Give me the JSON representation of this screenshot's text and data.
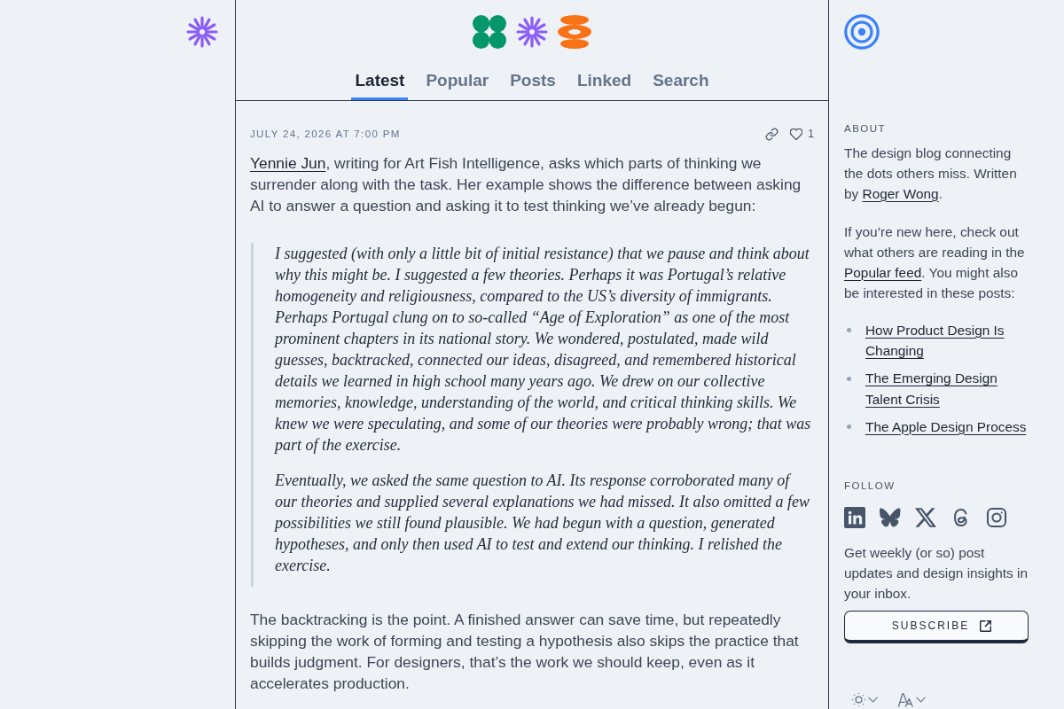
{
  "header": {
    "tabs": [
      {
        "label": "Latest",
        "selected": true
      },
      {
        "label": "Popular",
        "selected": false
      },
      {
        "label": "Posts",
        "selected": false
      },
      {
        "label": "Linked",
        "selected": false
      },
      {
        "label": "Search",
        "selected": false
      }
    ]
  },
  "post": {
    "date": "JULY 24, 2026 AT 7:00 PM",
    "like_count": "1",
    "intro": [
      {
        "kind": "link",
        "text": "Yennie Jun"
      },
      {
        "kind": "text",
        "text": ", writing for Art Fish Intelligence, asks which parts of thinking we surrender along with the task. Her example shows the difference between asking AI to answer a question and asking it to test thinking we’ve already begun:"
      }
    ],
    "quote": [
      "I suggested (with only a little bit of initial resistance) that we pause and think about why this might be. I suggested a few theories. Perhaps it was Portugal’s relative homogeneity and religiousness, compared to the US’s diversity of immigrants. Perhaps Portugal clung on to so-called “Age of Exploration” as one of the most prominent chapters in its national story. We wondered, postulated, made wild guesses, backtracked, connected our ideas, disagreed, and remembered historical details we learned in high school many years ago. We drew on our collective memories, knowledge, understanding of the world, and critical thinking skills. We knew we were speculating, and some of our theories were probably wrong; that was part of the exercise.",
      "Eventually, we asked the same question to AI. Its response corroborated many of our theories and supplied several explanations we had missed. It also omitted a few possibilities we still found plausible. We had begun with a question, generated hypotheses, and only then used AI to test and extend our thinking. I relished the exercise."
    ],
    "closing": "The backtracking is the point. A finished answer can save time, but repeatedly skipping the work of forming and testing a hypothesis also skips the practice that builds judgment. For designers, that’s the work we should keep, even as it accelerates production."
  },
  "sidebar": {
    "about": {
      "heading": "ABOUT",
      "paragraphs": [
        [
          {
            "kind": "text",
            "text": "The design blog connecting the dots others miss. Written by "
          },
          {
            "kind": "link",
            "text": "Roger Wong"
          },
          {
            "kind": "text",
            "text": "."
          }
        ],
        [
          {
            "kind": "text",
            "text": "If you’re new here, check out what others are reading in the "
          },
          {
            "kind": "link",
            "text": "Popular feed"
          },
          {
            "kind": "text",
            "text": ". You might also be interested in these posts:"
          }
        ]
      ],
      "posts": [
        "How Product Design Is Changing",
        "The Emerging Design Talent Crisis",
        "The Apple Design Process"
      ]
    },
    "follow": {
      "heading": "FOLLOW",
      "text": "Get weekly (or so) post updates and design insights in your inbox.",
      "subscribe_button": "SUBSCRIBE"
    }
  }
}
